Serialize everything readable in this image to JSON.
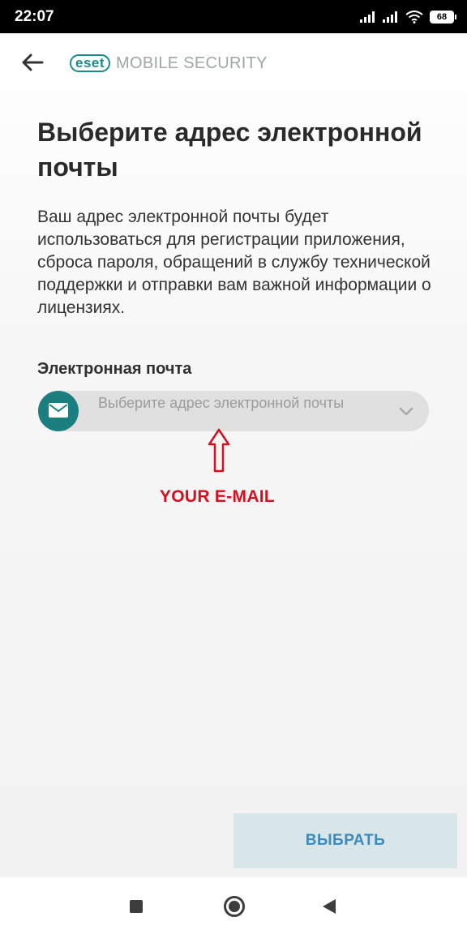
{
  "status_bar": {
    "time": "22:07",
    "battery": "68"
  },
  "header": {
    "back_icon": "arrow-left-icon",
    "logo_badge": "eset",
    "logo_text": "MOBILE SECURITY"
  },
  "main": {
    "title": "Выберите адрес электронной почты",
    "description": "Ваш адрес электронной почты будет использоваться для регистрации приложения, сброса пароля, обращений в службу технической поддержки и отправки вам важной информации о лицензиях.",
    "field_label": "Электронная почта",
    "email_select": {
      "placeholder": "Выберите адрес электронной почты",
      "icon": "mail-icon",
      "dropdown_icon": "chevron-down-icon"
    },
    "annotation": "YOUR E-MAIL"
  },
  "footer": {
    "choose_button": "ВЫБРАТЬ"
  },
  "colors": {
    "accent": "#1b7f80",
    "annotation": "#d40f1f",
    "button_text": "#3b8bbf",
    "button_bg": "#d8e5e9"
  }
}
